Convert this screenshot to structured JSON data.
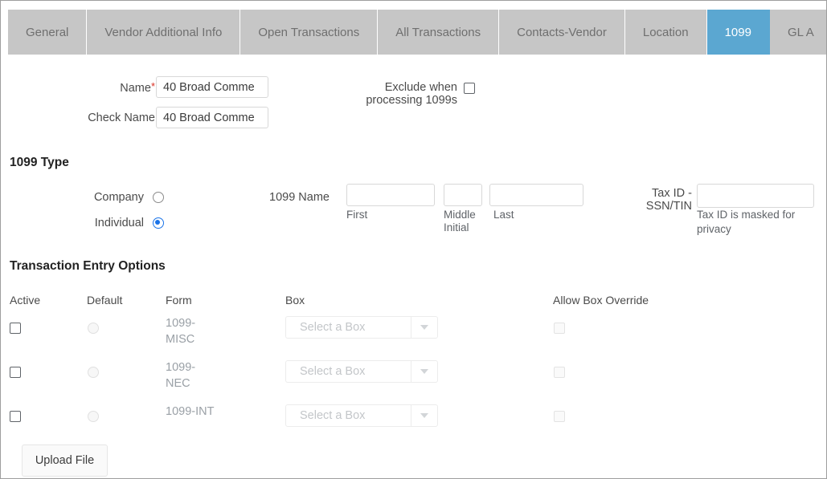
{
  "tabs": [
    {
      "label": "General",
      "active": false
    },
    {
      "label": "Vendor Additional Info",
      "active": false
    },
    {
      "label": "Open Transactions",
      "active": false
    },
    {
      "label": "All Transactions",
      "active": false
    },
    {
      "label": "Contacts-Vendor",
      "active": false
    },
    {
      "label": "Location",
      "active": false
    },
    {
      "label": "1099",
      "active": true
    },
    {
      "label": "GL A",
      "active": false
    }
  ],
  "colors": {
    "active_tab_bg": "#5ba7d1",
    "tab_bar_bg": "#c6c6c6",
    "tab_text": "#6f6f6f",
    "radio_selected": "#1a73e8",
    "required_asterisk": "#d93025"
  },
  "vendor": {
    "name_label": "Name",
    "name_required_mark": "*",
    "name_value": "40 Broad Comme",
    "check_name_label": "Check Name",
    "check_name_value": "40 Broad Comme",
    "exclude_label_line1": "Exclude when",
    "exclude_label_line2": "processing 1099s",
    "exclude_checked": false
  },
  "type_section": {
    "title": "1099 Type",
    "options": [
      {
        "label": "Company",
        "selected": false
      },
      {
        "label": "Individual",
        "selected": true
      }
    ],
    "name_label": "1099 Name",
    "first_value": "",
    "first_sublabel": "First",
    "middle_value": "",
    "middle_sublabel_line1": "Middle",
    "middle_sublabel_line2": "Initial",
    "last_value": "",
    "last_sublabel": "Last",
    "taxid_label_line1": "Tax ID -",
    "taxid_label_line2": "SSN/TIN",
    "taxid_value": "",
    "taxid_helper_line1": "Tax ID is masked for",
    "taxid_helper_line2": "privacy"
  },
  "transaction_options": {
    "title": "Transaction Entry Options",
    "columns": {
      "active": "Active",
      "default": "Default",
      "form": "Form",
      "box": "Box",
      "allow_override": "Allow Box Override"
    },
    "rows": [
      {
        "active_checked": false,
        "default_selected": false,
        "form_line1": "1099-",
        "form_line2": "MISC",
        "box_value": "Select a Box",
        "override_checked": false
      },
      {
        "active_checked": false,
        "default_selected": false,
        "form_line1": "1099-",
        "form_line2": "NEC",
        "box_value": "Select a Box",
        "override_checked": false
      },
      {
        "active_checked": false,
        "default_selected": false,
        "form_line1": "1099-INT",
        "form_line2": "",
        "box_value": "Select a Box",
        "override_checked": false
      }
    ]
  },
  "footer": {
    "upload_label": "Upload File"
  }
}
